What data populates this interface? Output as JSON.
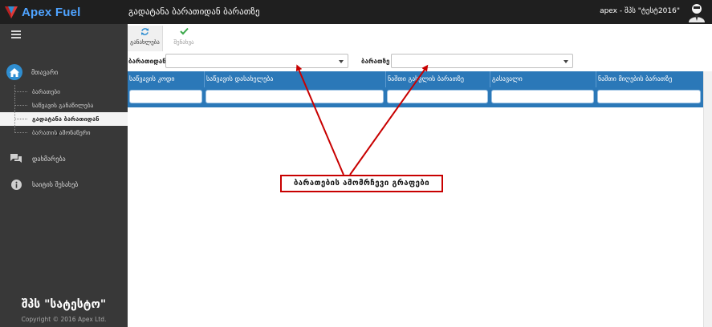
{
  "topbar": {
    "brand": "Apex Fuel",
    "page_title": "გადატანა ბარათიდან ბარათზე",
    "user": "apex - შპს \"ტესტ2016\""
  },
  "sidebar": {
    "main_item": "მთავარი",
    "sub_items": [
      {
        "label": "ბარათები",
        "active": false
      },
      {
        "label": "საწვავის განაწილება",
        "active": false
      },
      {
        "label": "გადატანა ბარათიდან ბარათზე",
        "active": true
      },
      {
        "label": "ბარათის ამონაწერი",
        "active": false
      }
    ],
    "help": "დახმარება",
    "about": "საიტის შესახებ",
    "company": "შპს \"სატესტო\"",
    "copyright": "Copyright © 2016 Apex Ltd."
  },
  "toolbar": {
    "refresh_label": "განახლება",
    "save_label": "შენახვა"
  },
  "filters": {
    "from_label": "ბარათიდან",
    "from_value": "",
    "to_label": "ბარათზე",
    "to_value": ""
  },
  "grid": {
    "columns": [
      "საწვავის კოდი",
      "საწვავის დასახელება",
      "ნაშთი გასვლის ბარათზე",
      "გასავალი",
      "ნაშთი მიღების ბარათზე"
    ],
    "rows": []
  },
  "annotation": {
    "text": "ბარათების ამომრჩევი გრაფები",
    "color": "#c80000"
  },
  "colors": {
    "topbar": "#1f1f1f",
    "sidebar": "#383838",
    "grid_header": "#2b78b8",
    "brand": "#4fa3ff",
    "accent": "#2f8ed1"
  }
}
